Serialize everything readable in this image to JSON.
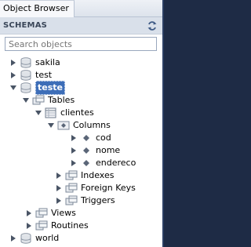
{
  "window": {
    "title": "Object Browser"
  },
  "header": {
    "section_label": "SCHEMAS"
  },
  "search": {
    "placeholder": "Search objects"
  },
  "tree": {
    "sakila": "sakila",
    "test": "test",
    "teste": "teste",
    "tables": "Tables",
    "clientes": "clientes",
    "columns": "Columns",
    "col_cod": "cod",
    "col_nome": "nome",
    "col_endereco": "endereco",
    "indexes": "Indexes",
    "foreign_keys": "Foreign Keys",
    "triggers": "Triggers",
    "views": "Views",
    "routines": "Routines",
    "world": "world"
  },
  "colors": {
    "selection": "#3d6eb8",
    "header_bg": "#d9e0ea",
    "window_frame": "#1e2b45"
  },
  "icons": {
    "refresh": "refresh-icon",
    "database": "database-icon",
    "folder": "tables-folder-icon",
    "table": "table-icon",
    "column": "column-icon"
  }
}
